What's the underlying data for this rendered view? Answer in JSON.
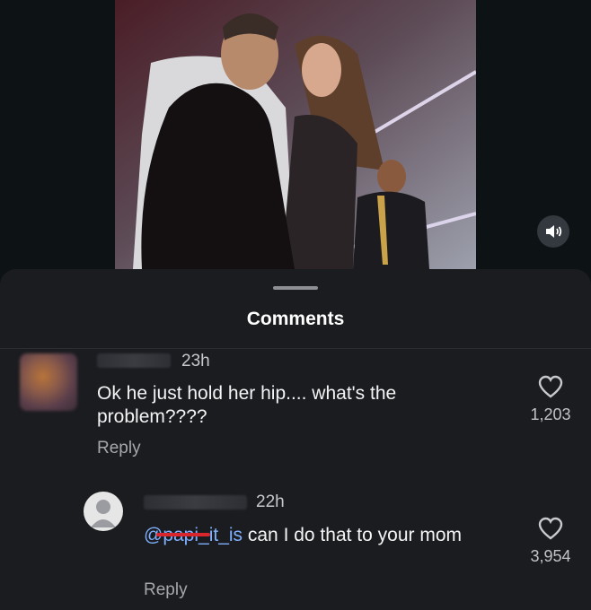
{
  "sheet": {
    "title": "Comments"
  },
  "comments": [
    {
      "time": "23h",
      "text": "Ok he just hold her hip.... what's the problem????",
      "reply_label": "Reply",
      "likes": "1,203"
    },
    {
      "time": "22h",
      "mention": "@papi_it_is",
      "text": " can I do that to your mom",
      "reply_label": "Reply",
      "likes": "3,954"
    }
  ],
  "icons": {
    "mute": "speaker-icon",
    "like": "heart-icon"
  },
  "colors": {
    "sheet_bg": "#1b1c20",
    "mention": "#7fb0ff",
    "redaction": "#d8262c"
  }
}
